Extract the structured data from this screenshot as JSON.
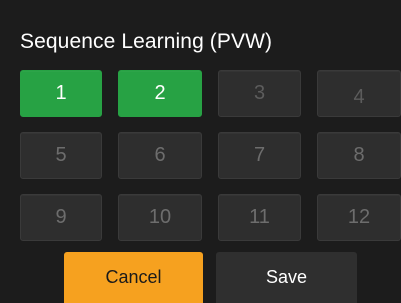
{
  "dialog": {
    "title": "Sequence Learning (PVW)"
  },
  "slots": [
    {
      "label": "1",
      "active": true
    },
    {
      "label": "2",
      "active": true
    },
    {
      "label": "3",
      "active": false
    },
    {
      "label": "4",
      "active": false
    },
    {
      "label": "5",
      "active": false
    },
    {
      "label": "6",
      "active": false
    },
    {
      "label": "7",
      "active": false
    },
    {
      "label": "8",
      "active": false
    },
    {
      "label": "9",
      "active": false
    },
    {
      "label": "10",
      "active": false
    },
    {
      "label": "11",
      "active": false
    },
    {
      "label": "12",
      "active": false
    }
  ],
  "buttons": {
    "cancel_label": "Cancel",
    "save_label": "Save"
  },
  "colors": {
    "active": "#27a244",
    "accent": "#f6a11f",
    "background": "#1c1c1c",
    "inactive_slot": "#2e2e2e"
  }
}
